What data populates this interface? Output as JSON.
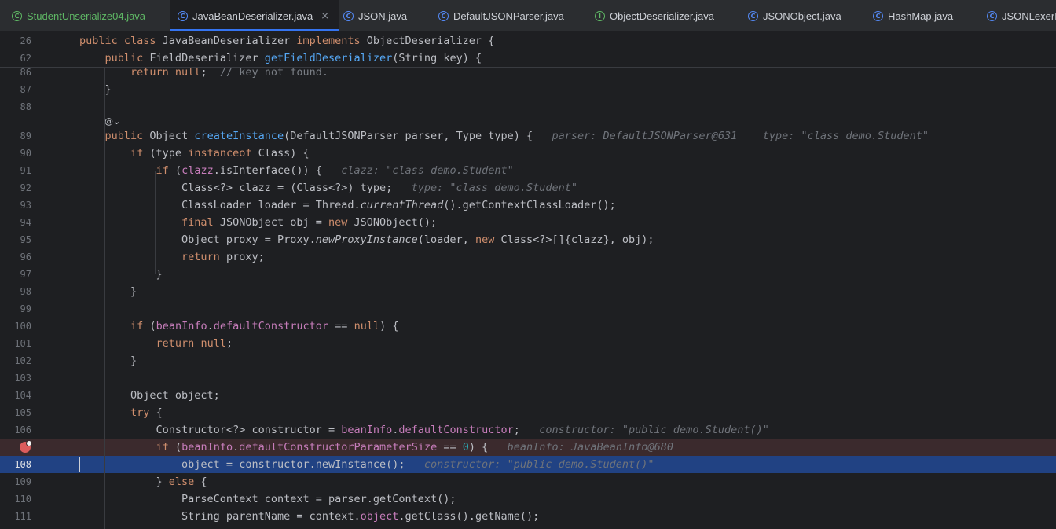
{
  "tabs": [
    {
      "label": "StudentUnserialize04.java",
      "icon": "class-icon-green",
      "active": false,
      "color": "#5fb865"
    },
    {
      "label": "JavaBeanDeserializer.java",
      "icon": "class-icon",
      "active": true
    },
    {
      "label": "JSON.java",
      "icon": "class-icon",
      "active": false
    },
    {
      "label": "DefaultJSONParser.java",
      "icon": "class-icon",
      "active": false
    },
    {
      "label": "ObjectDeserializer.java",
      "icon": "interface-icon",
      "active": false
    },
    {
      "label": "JSONObject.java",
      "icon": "class-icon",
      "active": false
    },
    {
      "label": "HashMap.java",
      "icon": "class-icon",
      "active": false
    },
    {
      "label": "JSONLexerB",
      "icon": "class-icon",
      "active": false
    }
  ],
  "tab_close_glyph": "×",
  "colors": {
    "keyword": "#cf8e6d",
    "method": "#56a8f5",
    "field": "#c77dbb",
    "number": "#2aacb8",
    "hint": "#6f737a",
    "selection": "#214283",
    "breakpoint_line": "#3b2a2d",
    "breakpoint": "#db5c5c"
  },
  "sticky_lines": [
    {
      "n": "26",
      "text": "public class JavaBeanDeserializer implements ObjectDeserializer {"
    },
    {
      "n": "62",
      "text": "    public FieldDeserializer getFieldDeserializer(String key) {"
    }
  ],
  "code_lines": [
    {
      "n": "86",
      "text": "        return null;  // key not found."
    },
    {
      "n": "87",
      "text": "    }"
    },
    {
      "n": "88",
      "text": ""
    },
    {
      "n": "89",
      "text": "    public Object createInstance(DefaultJSONParser parser, Type type) {",
      "hint": "parser: DefaultJSONParser@631    type: \"class demo.Student\""
    },
    {
      "n": "90",
      "text": "        if (type instanceof Class) {"
    },
    {
      "n": "91",
      "text": "            if (clazz.isInterface()) {",
      "hint": "clazz: \"class demo.Student\""
    },
    {
      "n": "92",
      "text": "                Class<?> clazz = (Class<?>) type;",
      "hint": "type: \"class demo.Student\""
    },
    {
      "n": "93",
      "text": "                ClassLoader loader = Thread.currentThread().getContextClassLoader();"
    },
    {
      "n": "94",
      "text": "                final JSONObject obj = new JSONObject();"
    },
    {
      "n": "95",
      "text": "                Object proxy = Proxy.newProxyInstance(loader, new Class<?>[]{clazz}, obj);"
    },
    {
      "n": "96",
      "text": "                return proxy;"
    },
    {
      "n": "97",
      "text": "            }"
    },
    {
      "n": "98",
      "text": "        }"
    },
    {
      "n": "99",
      "text": ""
    },
    {
      "n": "100",
      "text": "        if (beanInfo.defaultConstructor == null) {"
    },
    {
      "n": "101",
      "text": "            return null;"
    },
    {
      "n": "102",
      "text": "        }"
    },
    {
      "n": "103",
      "text": ""
    },
    {
      "n": "104",
      "text": "        Object object;"
    },
    {
      "n": "105",
      "text": "        try {"
    },
    {
      "n": "106",
      "text": "            Constructor<?> constructor = beanInfo.defaultConstructor;",
      "hint": "constructor: \"public demo.Student()\""
    },
    {
      "n": "",
      "text": "            if (beanInfo.defaultConstructorParameterSize == 0) {",
      "hint": "beanInfo: JavaBeanInfo@680"
    },
    {
      "n": "108",
      "text": "                object = constructor.newInstance();",
      "hint": "constructor: \"public demo.Student()\""
    },
    {
      "n": "109",
      "text": "            } else {"
    },
    {
      "n": "110",
      "text": "                ParseContext context = parser.getContext();"
    },
    {
      "n": "111",
      "text": "                String parentName = context.object.getClass().getName();"
    }
  ]
}
